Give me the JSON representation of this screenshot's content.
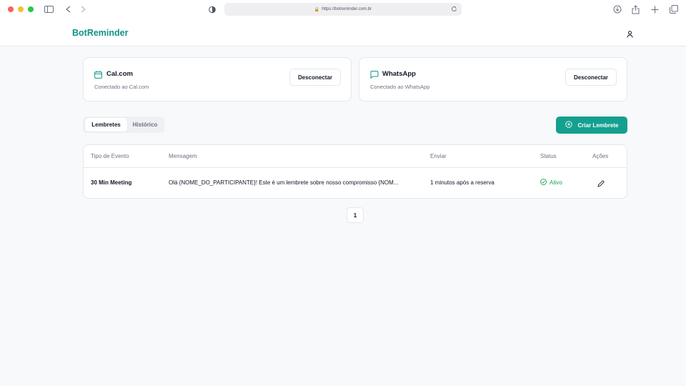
{
  "browser": {
    "url": "https://botreminder.com.br"
  },
  "header": {
    "brand": "BotReminder"
  },
  "integrations": [
    {
      "title": "Cal.com",
      "status": "Conectado ao Cal.com",
      "button": "Desconectar"
    },
    {
      "title": "WhatsApp",
      "status": "Conectado ao WhatsApp",
      "button": "Desconectar"
    }
  ],
  "tabs": [
    {
      "label": "Lembretes",
      "active": true
    },
    {
      "label": "Histórico",
      "active": false
    }
  ],
  "create_button": "Criar Lembrete",
  "table": {
    "headers": [
      "Tipo de Evento",
      "Mensagem",
      "Enviar",
      "Status",
      "Ações"
    ],
    "rows": [
      {
        "event": "30 Min Meeting",
        "message": "Olá {NOME_DO_PARTICIPANTE}! Este é um lembrete sobre nosso compromisso {NOM...",
        "send": "1 minutos após a reserva",
        "status": "Ativo"
      }
    ]
  },
  "pagination": {
    "current": "1"
  },
  "colors": {
    "accent": "#0d9488",
    "success": "#16a34a"
  }
}
